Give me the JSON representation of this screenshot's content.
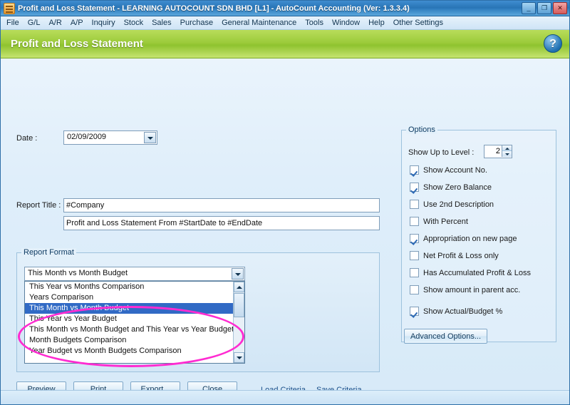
{
  "window": {
    "title": "Profit and Loss Statement - LEARNING AUTOCOUNT SDN BHD [L1] - AutoCount Accounting (Ver: 1.3.3.4)",
    "app_icon": "ledger-icon",
    "minimize_label": "_",
    "maximize_label": "❐",
    "close_label": "✕"
  },
  "menubar": {
    "items": [
      {
        "label": "File"
      },
      {
        "label": "G/L"
      },
      {
        "label": "A/R"
      },
      {
        "label": "A/P"
      },
      {
        "label": "Inquiry"
      },
      {
        "label": "Stock"
      },
      {
        "label": "Sales"
      },
      {
        "label": "Purchase"
      },
      {
        "label": "General Maintenance"
      },
      {
        "label": "Tools"
      },
      {
        "label": "Window"
      },
      {
        "label": "Help"
      },
      {
        "label": "Other Settings"
      }
    ]
  },
  "header": {
    "title": "Profit and Loss Statement",
    "help_label": "?"
  },
  "form": {
    "date_label": "Date :",
    "date_value": "02/09/2009",
    "report_title_label": "Report Title :",
    "report_title_line1": "#Company",
    "report_title_line2": "Profit and Loss Statement From #StartDate to #EndDate"
  },
  "report_format": {
    "group_label": "Report Format",
    "selected": "This Month vs Month Budget",
    "dropdown_open": true,
    "options": [
      {
        "label": "This Year vs Months Comparison",
        "selected": false
      },
      {
        "label": "Years Comparison",
        "selected": false
      },
      {
        "label": "This Month vs Month Budget",
        "selected": true
      },
      {
        "label": "This Year vs Year Budget",
        "selected": false
      },
      {
        "label": "This Month vs Month Budget and This Year vs Year Budget",
        "selected": false
      },
      {
        "label": "Month Budgets Comparison",
        "selected": false
      },
      {
        "label": "Year Budget vs Month Budgets Comparison",
        "selected": false
      }
    ],
    "scrollbar": {
      "up_arrow": "scroll-up-icon",
      "down_arrow": "scroll-down-icon"
    }
  },
  "options": {
    "group_label": "Options",
    "show_up_to_level_label": "Show Up to Level :",
    "show_up_to_level_value": "2",
    "checkboxes": [
      {
        "label": "Show Account No.",
        "checked": true
      },
      {
        "label": "Show Zero Balance",
        "checked": true
      },
      {
        "label": "Use 2nd Description",
        "checked": false
      },
      {
        "label": "With Percent",
        "checked": false
      },
      {
        "label": "Appropriation on new page",
        "checked": true
      },
      {
        "label": "Net Profit & Loss only",
        "checked": false
      },
      {
        "label": "Has Accumulated Profit & Loss",
        "checked": false
      },
      {
        "label": "Show amount in parent acc.",
        "checked": false
      },
      {
        "label": "Show Actual/Budget %",
        "checked": true
      }
    ],
    "advanced_button": "Advanced Options..."
  },
  "actions": {
    "buttons": [
      {
        "label": "Preview"
      },
      {
        "label": "Print"
      },
      {
        "label": "Export..."
      },
      {
        "label": "Close"
      }
    ],
    "links": [
      {
        "label": "Load Criteria"
      },
      {
        "label": "Save Criteria"
      }
    ]
  },
  "annotation": {
    "shape": "ellipse-highlight",
    "color": "#ff2bd1"
  }
}
